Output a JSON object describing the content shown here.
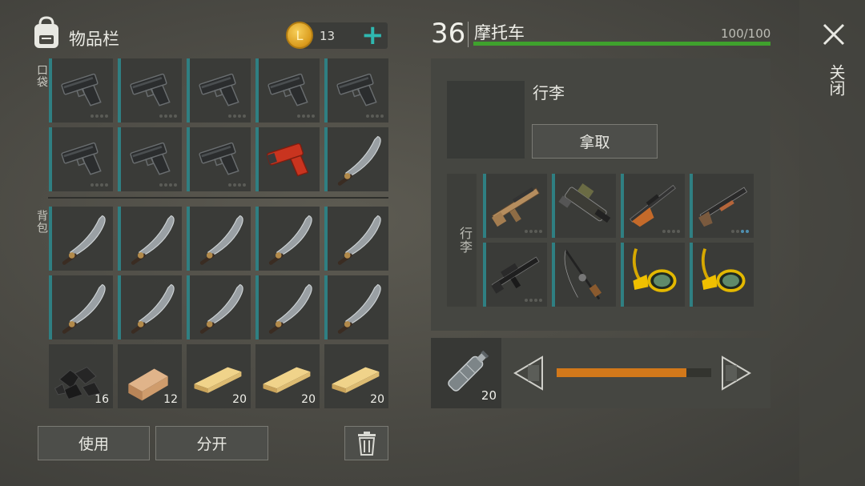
{
  "inventory": {
    "title": "物品栏",
    "coin_count": "13",
    "pocket_label": "口袋",
    "backpack_label": "背包",
    "use_label": "使用",
    "split_label": "分开",
    "quantities": {
      "coal": "16",
      "wood_block": "12",
      "plank1": "20",
      "plank2": "20",
      "plank3": "20"
    }
  },
  "vehicle": {
    "level": "36",
    "name": "摩托车",
    "hp_text": "100/100",
    "hp_fraction": 1.0,
    "luggage_title": "行李",
    "take_label": "拿取",
    "luggage_side_label": "行李",
    "close_label": "关闭"
  },
  "bottle": {
    "quantity": "20",
    "amount_fraction": 0.84
  },
  "colors": {
    "accent_teal": "#2f7f82",
    "hp_green": "#3fa12d",
    "progress_orange": "#d2781a"
  },
  "icons": [
    "backpack-icon",
    "coin-icon",
    "plus-icon",
    "pistol-icon",
    "flare-gun-icon",
    "machete-icon",
    "coal-icon",
    "wood-block-icon",
    "plank-icon",
    "trash-icon",
    "close-icon",
    "assault-rifle-icon",
    "machine-gun-icon",
    "hunting-rifle-icon",
    "shotgun-icon",
    "m16-icon",
    "fishing-rod-icon",
    "snorkel-mask-icon",
    "water-bottle-icon",
    "arrow-left-icon",
    "arrow-right-icon"
  ]
}
